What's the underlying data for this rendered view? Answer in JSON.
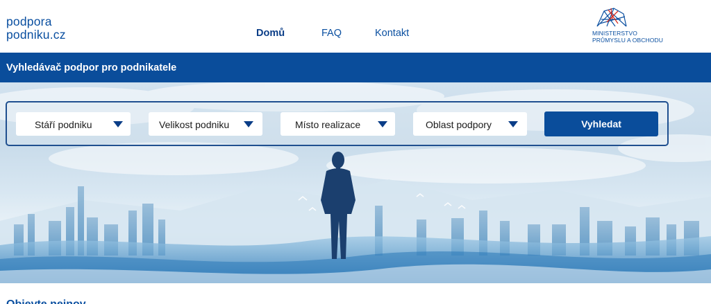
{
  "header": {
    "logo_line1": "podpora",
    "logo_line2": "podniku.cz",
    "nav": [
      {
        "label": "Domů",
        "active": true
      },
      {
        "label": "FAQ",
        "active": false
      },
      {
        "label": "Kontakt",
        "active": false
      }
    ],
    "ministry_line1": "MINISTERSTVO",
    "ministry_line2": "PRŮMYSLU A OBCHODU"
  },
  "title_bar": {
    "title": "Vyhledávač podpor pro podnikatele"
  },
  "filters": {
    "selects": [
      {
        "label": "Stáří podniku",
        "icon": "triangle-down-icon"
      },
      {
        "label": "Velikost podniku",
        "icon": "triangle-down-icon"
      },
      {
        "label": "Místo realizace",
        "icon": "triangle-down-icon"
      },
      {
        "label": "Oblast podpory",
        "icon": "triangle-down-icon"
      }
    ],
    "search_button": "Vyhledat"
  },
  "next_section": {
    "heading_peek": "Objevte nejnov"
  },
  "colors": {
    "brand_blue": "#0a4d9b",
    "dark_blue": "#0a3d87",
    "ministry_red": "#d52b1e",
    "sky": "#c8dbea"
  }
}
